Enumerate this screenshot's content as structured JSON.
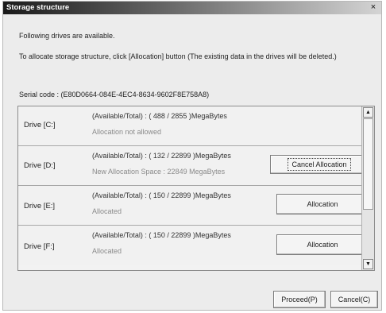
{
  "dialog": {
    "title": "Storage structure",
    "close_glyph": "×",
    "info_line1": "Following drives are available.",
    "info_line2": "To allocate storage structure, click [Allocation] button (The existing data in the drives will be deleted.)",
    "serial_label": "Serial code : (E80D0664-084E-4EC4-8634-9602F8E758A8)"
  },
  "drives": [
    {
      "name": "Drive [C:]",
      "availability": "(Available/Total) : ( 488 / 2855 )MegaBytes",
      "status": "Allocation not allowed",
      "button": ""
    },
    {
      "name": "Drive [D:]",
      "availability": "(Available/Total) : ( 132 / 22899 )MegaBytes",
      "status": "New Allocation Space : 22849 MegaBytes",
      "button": "Cancel Allocation"
    },
    {
      "name": "Drive [E:]",
      "availability": "(Available/Total) : ( 150 / 22899 )MegaBytes",
      "status": "Allocated",
      "button": "Allocation"
    },
    {
      "name": "Drive [F:]",
      "availability": "(Available/Total) : ( 150 / 22899 )MegaBytes",
      "status": "Allocated",
      "button": "Allocation"
    }
  ],
  "scrollbar": {
    "up_icon": "▲",
    "down_icon": "▼"
  },
  "footer": {
    "proceed_label": "Proceed(P)",
    "cancel_label": "Cancel(C)"
  }
}
